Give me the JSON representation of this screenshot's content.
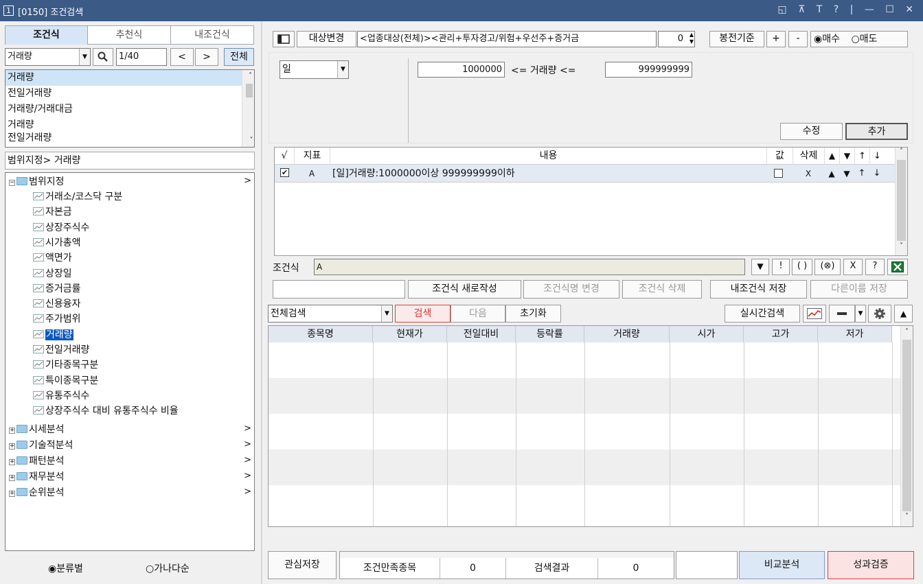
{
  "window": {
    "number": "1",
    "title": "[0150] 조건검색",
    "controls": "◱ ⊼ T ? | — ☐ ✕"
  },
  "left": {
    "tabs": [
      "조건식",
      "추천식",
      "내조건식"
    ],
    "search_select": "거래량",
    "page": "1/40",
    "prev": "<",
    "next": ">",
    "all_button": "전체",
    "results": [
      "거래량",
      "전일거래량",
      "거래량/거래대금",
      "거래량",
      "전일거래량"
    ],
    "path": "범위지정> 거래량",
    "tree_root": "범위지정",
    "tree_children": [
      "거래소/코스닥 구분",
      "자본금",
      "상장주식수",
      "시가총액",
      "액면가",
      "상장일",
      "증거금률",
      "신용융자",
      "주가범위",
      "거래량",
      "전일거래량",
      "기타종목구분",
      "특이종목구분",
      "유통주식수",
      "상장주식수 대비 유통주식수 비율"
    ],
    "tree_folders": [
      "시세분석",
      "기술적분석",
      "패턴분석",
      "재무분석",
      "순위분석"
    ],
    "sort_options": [
      "분류별",
      "가나다순"
    ],
    "sort_selected": "분류별"
  },
  "toolbar": {
    "target_change": "대상변경",
    "target_text": "<업종대상(전체)><관리+투자경고/위험+우선주+증거금",
    "offset": "0",
    "candle_basis": "봉전기준",
    "plus": "+",
    "minus": "-",
    "buy": "매수",
    "sell": "매도"
  },
  "criteria": {
    "period": "일",
    "min": "1000000",
    "op1": "<= 거래량 <=",
    "max": "999999999",
    "edit_button": "수정",
    "add_button": "추가"
  },
  "cond_table": {
    "headers": [
      "√",
      "지표",
      "내용",
      "값",
      "삭제",
      "▲",
      "▼",
      "↑",
      "↓"
    ],
    "rows": [
      {
        "checked": true,
        "indicator": "A",
        "content": "[일]거래량:1000000이상 999999999이하",
        "del": "X",
        "up": "▲",
        "down": "▼",
        "top": "↑",
        "bottom": "↓"
      }
    ]
  },
  "formula": {
    "label": "조건식",
    "value": "A",
    "symbols": [
      "▼",
      "!",
      "( )",
      "(⊗)",
      "X",
      "?"
    ]
  },
  "actions": {
    "new": "조건식 새로작성",
    "rename": "조건식명 변경",
    "delete": "조건식 삭제",
    "save": "내조건식 저장",
    "save_as": "다른이름 저장"
  },
  "search": {
    "mode": "전체검색",
    "search": "검색",
    "next": "다음",
    "reset": "초기화",
    "realtime": "실시간검색"
  },
  "results_table": {
    "headers": [
      "종목명",
      "현재가",
      "전일대비",
      "등락률",
      "거래량",
      "시가",
      "고가",
      "저가"
    ]
  },
  "status": {
    "watch_save": "관심저장",
    "satisfied_label": "조건만족종목",
    "satisfied": "0",
    "result_label": "검색결과",
    "result": "0",
    "compare": "비교분석",
    "verify": "성과검증"
  },
  "colors": {
    "title_bar": "#3b5a86",
    "selected": "#0a57c2",
    "search_border": "#e0403c"
  }
}
